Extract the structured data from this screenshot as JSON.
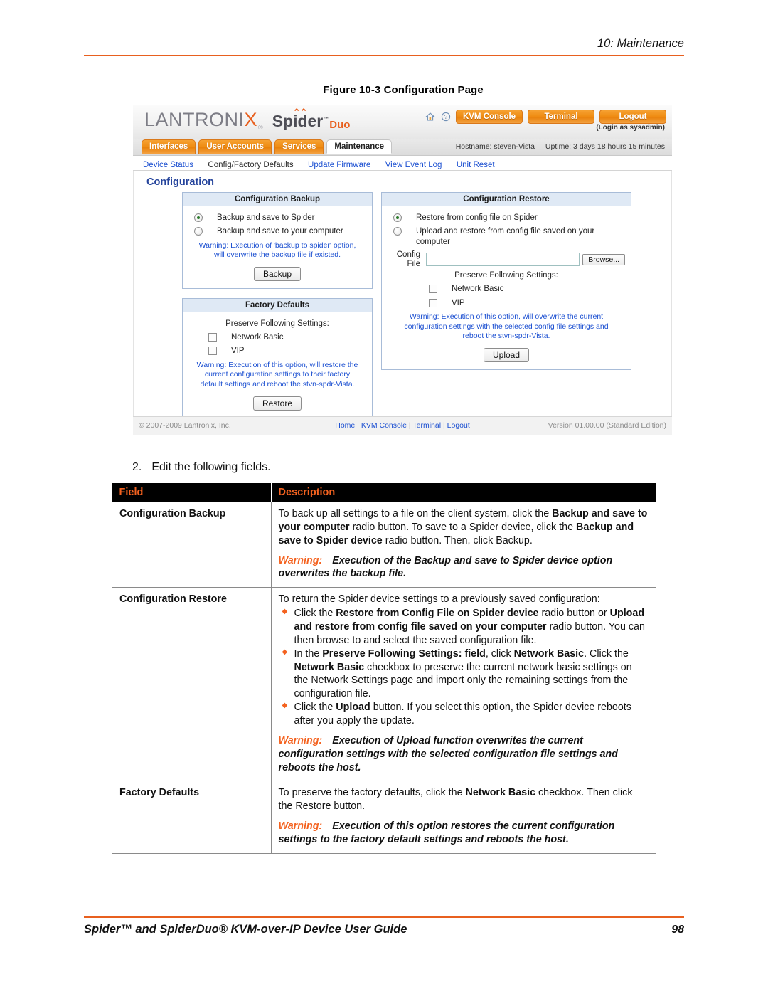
{
  "page": {
    "running_head": "10: Maintenance",
    "footer_title": "Spider™ and SpiderDuo® KVM-over-IP Device User Guide",
    "page_number": "98",
    "accent_color": "#e8601f"
  },
  "figure": {
    "caption": "Figure 10-3  Configuration Page"
  },
  "screenshot": {
    "brand": {
      "lantronix": "LANTRONIX",
      "registered": "®",
      "spider": "Spider",
      "tm": "™",
      "duo": "Duo"
    },
    "header_icons": [
      {
        "name": "home-icon",
        "glyph": "⌂"
      },
      {
        "name": "help-icon",
        "glyph": "?"
      }
    ],
    "header_buttons": [
      {
        "label": "KVM Console"
      },
      {
        "label": "Terminal"
      },
      {
        "label": "Logout"
      }
    ],
    "login_as": "(Login as sysadmin)",
    "tabs": [
      {
        "label": "Interfaces",
        "active": false
      },
      {
        "label": "User Accounts",
        "active": false
      },
      {
        "label": "Services",
        "active": false
      },
      {
        "label": "Maintenance",
        "active": true
      }
    ],
    "hostname": "Hostname: steven-Vista",
    "uptime": "Uptime: 3 days 18 hours 15 minutes",
    "subnav": [
      {
        "label": "Device Status",
        "current": false
      },
      {
        "label": "Config/Factory Defaults",
        "current": true
      },
      {
        "label": "Update Firmware",
        "current": false
      },
      {
        "label": "View Event Log",
        "current": false
      },
      {
        "label": "Unit Reset",
        "current": false
      }
    ],
    "page_title": "Configuration",
    "config_backup": {
      "heading": "Configuration Backup",
      "option1": "Backup and save to Spider",
      "option2": "Backup and save to your computer",
      "warning_line1": "Warning: Execution of 'backup to spider' option,",
      "warning_line2": "will overwrite the backup file if existed.",
      "button": "Backup"
    },
    "factory_defaults": {
      "heading": "Factory Defaults",
      "preserve_label": "Preserve Following Settings:",
      "check1": "Network Basic",
      "check2": "VIP",
      "warning_line1": "Warning: Execution of this option, will restore the",
      "warning_line2": "current configuration settings to their factory",
      "warning_line3": "default settings and reboot the stvn-spdr-Vista.",
      "button": "Restore"
    },
    "config_restore": {
      "heading": "Configuration Restore",
      "option1": "Restore from config file on Spider",
      "option2": "Upload and restore from config file saved on your computer",
      "config_file_label_line1": "Config",
      "config_file_label_line2": "File",
      "config_file_value": "",
      "browse_button": "Browse...",
      "preserve_label": "Preserve Following Settings:",
      "check1": "Network Basic",
      "check2": "VIP",
      "warning_line1": "Warning: Execution of this option, will overwrite the current",
      "warning_line2": "configuration settings with the selected config file settings and",
      "warning_line3": "reboot the stvn-spdr-Vista.",
      "button": "Upload"
    },
    "footer": {
      "copyright": "© 2007-2009 Lantronix, Inc.",
      "links": [
        "Home",
        "KVM Console",
        "Terminal",
        "Logout"
      ],
      "version": "Version 01.00.00 (Standard Edition)"
    }
  },
  "step": {
    "number": "2.",
    "text": "Edit the following fields."
  },
  "table": {
    "headers": {
      "field": "Field",
      "description": "Description"
    },
    "rows": [
      {
        "field": "Configuration Backup",
        "para": "To back up all settings to a file on the client system, click the Backup and save to your computer radio button. To save to a Spider device, click the Backup and save to Spider device radio button. Then, click Backup.",
        "warning_label": "Warning:",
        "warning": "Execution of the Backup and save to Spider device option overwrites the backup file."
      },
      {
        "field": "Configuration Restore",
        "para": "To return the Spider device settings to a previously saved configuration:",
        "bullets": [
          "Click the Restore from Config File on Spider device radio button or Upload and restore from config file saved on your computer radio button. You can then browse to and select the saved configuration file.",
          "In the Preserve Following Settings: field, click Network Basic. Click the Network Basic checkbox to preserve the current network basic settings on the Network Settings page and import only the remaining settings from the configuration file.",
          "Click the Upload button. If you select this option, the Spider device reboots after you apply the update."
        ],
        "warning_label": "Warning:",
        "warning": "Execution of Upload function overwrites the current configuration settings with the selected configuration file settings and reboots the host."
      },
      {
        "field": "Factory Defaults",
        "para": "To preserve the factory defaults, click the Network Basic checkbox. Then click the Restore button.",
        "warning_label": "Warning:",
        "warning": "Execution of this option restores the current configuration settings to the factory default settings and reboots the host."
      }
    ]
  }
}
